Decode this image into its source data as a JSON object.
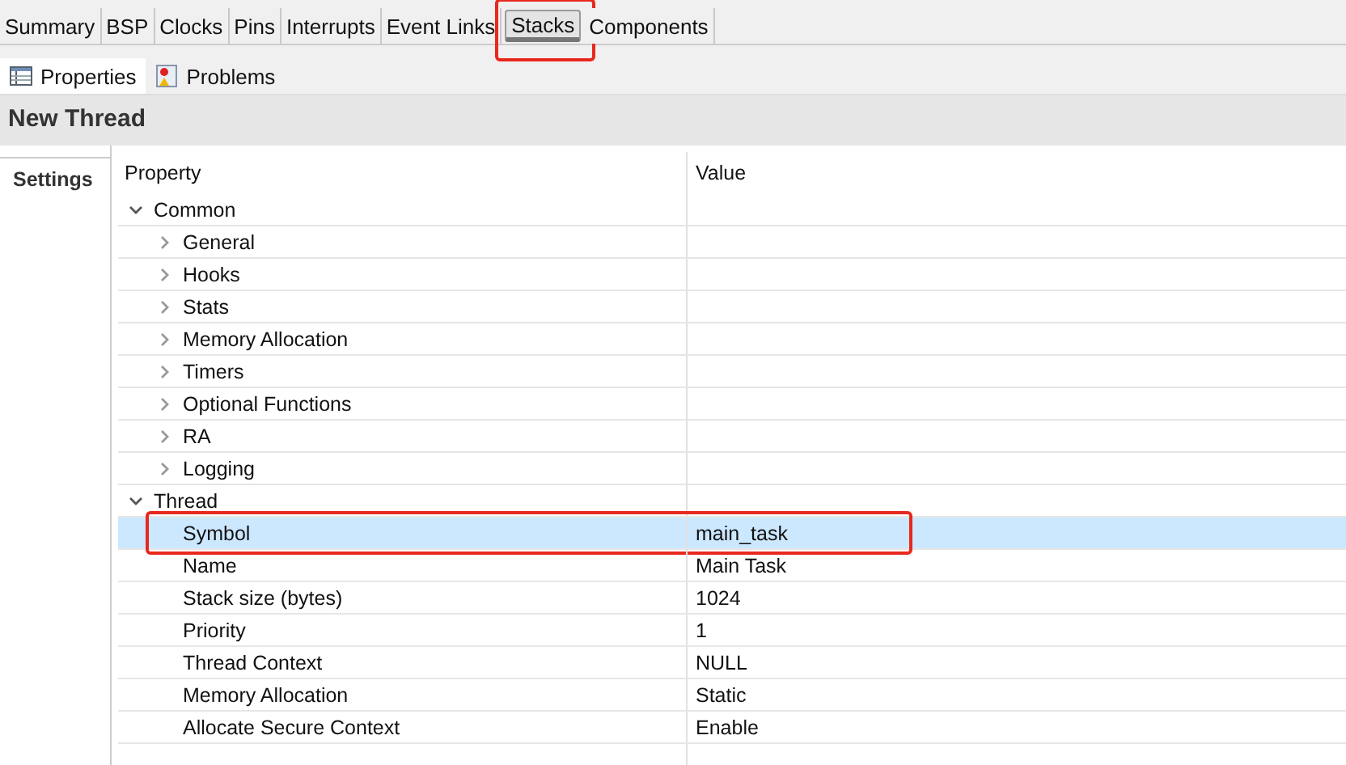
{
  "editor_tabs": [
    {
      "label": "Summary",
      "selected": false,
      "annotated": false
    },
    {
      "label": "BSP",
      "selected": false,
      "annotated": false
    },
    {
      "label": "Clocks",
      "selected": false,
      "annotated": false
    },
    {
      "label": "Pins",
      "selected": false,
      "annotated": false
    },
    {
      "label": "Interrupts",
      "selected": false,
      "annotated": false
    },
    {
      "label": "Event Links",
      "selected": false,
      "annotated": false
    },
    {
      "label": "Stacks",
      "selected": true,
      "annotated": true
    },
    {
      "label": "Components",
      "selected": false,
      "annotated": false
    }
  ],
  "view_tabs": [
    {
      "label": "Properties",
      "selected": true,
      "kind": "properties"
    },
    {
      "label": "Problems",
      "selected": false,
      "kind": "problems"
    }
  ],
  "title": "New Thread",
  "side_tabs": [
    {
      "label": "Settings",
      "selected": true
    }
  ],
  "table": {
    "columns": [
      "Property",
      "Value"
    ],
    "rows": [
      {
        "label": "Common",
        "expanded": true,
        "children": [
          {
            "label": "General",
            "expanded": false
          },
          {
            "label": "Hooks",
            "expanded": false
          },
          {
            "label": "Stats",
            "expanded": false
          },
          {
            "label": "Memory Allocation",
            "expanded": false
          },
          {
            "label": "Timers",
            "expanded": false
          },
          {
            "label": "Optional Functions",
            "expanded": false
          },
          {
            "label": "RA",
            "expanded": false
          },
          {
            "label": "Logging",
            "expanded": false
          }
        ]
      },
      {
        "label": "Thread",
        "expanded": true,
        "children": [
          {
            "label": "Symbol",
            "value": "main_task",
            "selected": true,
            "annotated": true
          },
          {
            "label": "Name",
            "value": "Main Task",
            "selected": false,
            "annotated": false
          },
          {
            "label": "Stack size (bytes)",
            "value": "1024",
            "selected": false,
            "annotated": false
          },
          {
            "label": "Priority",
            "value": "1",
            "selected": false,
            "annotated": false
          },
          {
            "label": "Thread Context",
            "value": "NULL",
            "selected": false,
            "annotated": false
          },
          {
            "label": "Memory Allocation",
            "value": "Static",
            "selected": false,
            "annotated": false
          },
          {
            "label": "Allocate Secure Context",
            "value": "Enable",
            "selected": false,
            "annotated": false
          }
        ]
      }
    ]
  }
}
